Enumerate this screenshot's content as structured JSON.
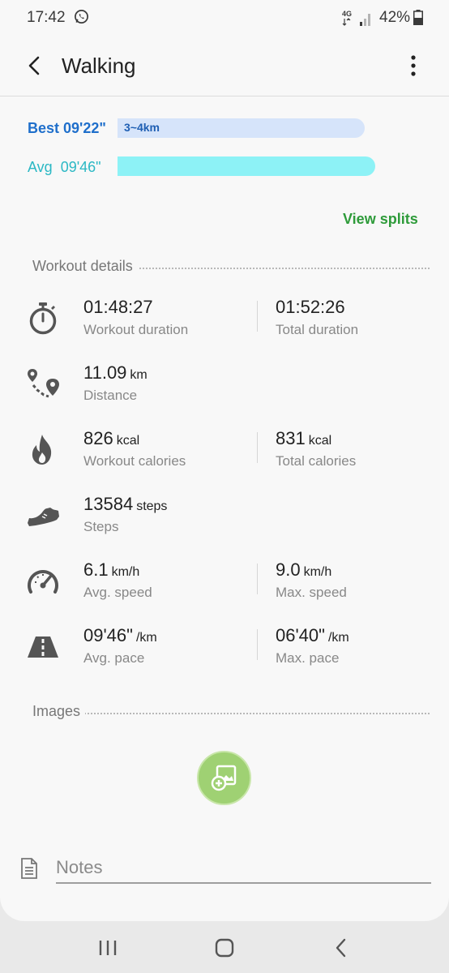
{
  "status_bar": {
    "time": "17:42",
    "network": "4G",
    "battery": "42%"
  },
  "app_bar": {
    "title": "Walking"
  },
  "splits": {
    "best_label": "Best 09'22\"",
    "best_range": "3~4km",
    "avg_label": "Avg  09'46\"",
    "view_splits": "View splits"
  },
  "workout_details": {
    "header": "Workout details",
    "rows": [
      {
        "icon": "stopwatch-icon",
        "left": {
          "value": "01:48:27",
          "unit": "",
          "label": "Workout duration"
        },
        "right": {
          "value": "01:52:26",
          "unit": "",
          "label": "Total duration"
        }
      },
      {
        "icon": "route-icon",
        "left": {
          "value": "11.09",
          "unit": "km",
          "label": "Distance"
        }
      },
      {
        "icon": "flame-icon",
        "left": {
          "value": "826",
          "unit": "kcal",
          "label": "Workout calories"
        },
        "right": {
          "value": "831",
          "unit": "kcal",
          "label": "Total calories"
        }
      },
      {
        "icon": "shoe-icon",
        "left": {
          "value": "13584",
          "unit": "steps",
          "label": "Steps"
        }
      },
      {
        "icon": "speedometer-icon",
        "left": {
          "value": "6.1",
          "unit": "km/h",
          "label": "Avg. speed"
        },
        "right": {
          "value": "9.0",
          "unit": "km/h",
          "label": "Max. speed"
        }
      },
      {
        "icon": "road-icon",
        "left": {
          "value": "09'46\"",
          "unit": "/km",
          "label": "Avg. pace"
        },
        "right": {
          "value": "06'40\"",
          "unit": "/km",
          "label": "Max. pace"
        }
      }
    ]
  },
  "images": {
    "header": "Images"
  },
  "notes": {
    "placeholder": "Notes",
    "value": ""
  },
  "colors": {
    "best": "#1f6fcb",
    "avg": "#2bb8c4",
    "view_splits": "#2e9b3a",
    "add_image": "#9fd173"
  }
}
